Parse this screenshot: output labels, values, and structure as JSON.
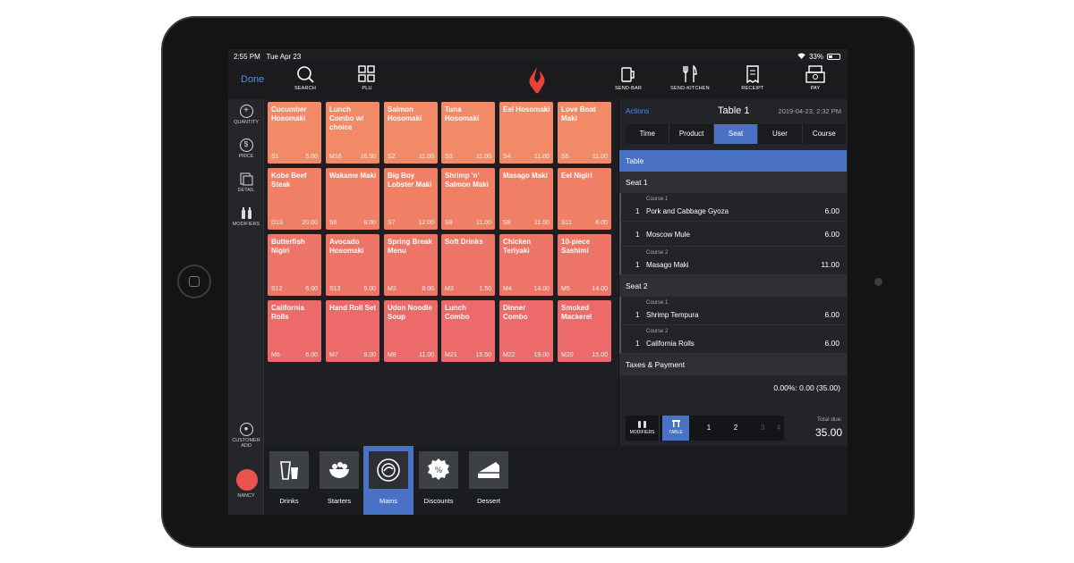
{
  "status": {
    "time": "2:55 PM",
    "date": "Tue Apr 23",
    "battery": "33%"
  },
  "toolbar": {
    "done_label": "Done",
    "search_label": "SEARCH",
    "plu_label": "PLU",
    "send_bar_label": "SEND-BAR",
    "send_kitchen_label": "SEND-KITCHEN",
    "receipt_label": "RECEIPT",
    "pay_label": "PAY"
  },
  "sidebar": {
    "quantity_label": "QUANTITY",
    "price_label": "PRICE",
    "detail_label": "DETAIL",
    "modifiers_label": "MODIFIERS",
    "customer_label": "CUSTOMER",
    "add_label": "ADD",
    "user_label": "NANCY"
  },
  "colors": {
    "accent": "#4a72c4",
    "link": "#4f8dfc",
    "tile_light": "#f08c6a",
    "tile_dark": "#ec6a6a"
  },
  "products": [
    [
      {
        "name": "Cucumber Hosomaki",
        "code": "S1",
        "price": "5.00"
      },
      {
        "name": "Lunch Combo w/ choice",
        "code": "M16",
        "price": "16.50"
      },
      {
        "name": "Salmon Hosomaki",
        "code": "S2",
        "price": "11.00"
      },
      {
        "name": "Tuna Hosomaki",
        "code": "S3",
        "price": "11.00"
      },
      {
        "name": "Eel Hosomaki",
        "code": "S4",
        "price": "11.00"
      },
      {
        "name": "Love Boat Maki",
        "code": "S5",
        "price": "11.00"
      }
    ],
    [
      {
        "name": "Kobe Beef Steak",
        "code": "D13",
        "price": "20.00"
      },
      {
        "name": "Wakame Maki",
        "code": "S6",
        "price": "8.00"
      },
      {
        "name": "Big Boy Lobster Maki",
        "code": "S7",
        "price": "12.00"
      },
      {
        "name": "Shrimp 'n' Salmon Maki",
        "code": "S8",
        "price": "11.00"
      },
      {
        "name": "Masago Maki",
        "code": "S9",
        "price": "11.00"
      },
      {
        "name": "Eel Nigiri",
        "code": "S11",
        "price": "6.00"
      }
    ],
    [
      {
        "name": "Butterfish Nigiri",
        "code": "S12",
        "price": "6.00"
      },
      {
        "name": "Avocado Hosomaki",
        "code": "S13",
        "price": "5.00"
      },
      {
        "name": "Spring Break Menu",
        "code": "M2",
        "price": "8.00"
      },
      {
        "name": "Soft Drinks",
        "code": "M3",
        "price": "1.50"
      },
      {
        "name": "Chicken Teriyaki",
        "code": "M4",
        "price": "14.00"
      },
      {
        "name": "10-piece Sashimi",
        "code": "M5",
        "price": "14.00"
      }
    ],
    [
      {
        "name": "California Rolls",
        "code": "M6",
        "price": "6.00"
      },
      {
        "name": "Hand Roll Set",
        "code": "M7",
        "price": "9.00"
      },
      {
        "name": "Udon Noodle Soup",
        "code": "M8",
        "price": "11.00"
      },
      {
        "name": "Lunch Combo",
        "code": "M21",
        "price": "15.50"
      },
      {
        "name": "Dinner Combo",
        "code": "M22",
        "price": "19.00"
      },
      {
        "name": "Smoked Mackerel",
        "code": "M20",
        "price": "15.00"
      }
    ]
  ],
  "order": {
    "actions_label": "Actions",
    "title": "Table 1",
    "datetime": "2019-04-23, 2:32 PM",
    "tabs": [
      "Time",
      "Product",
      "Seat",
      "User",
      "Course"
    ],
    "active_tab": "Seat",
    "table_section": "Table",
    "seat1_label": "Seat 1",
    "seat2_label": "Seat 2",
    "items": [
      {
        "course": "Course 1",
        "qty": "1",
        "name": "Pork and Cabbage Gyoza",
        "amount": "6.00"
      },
      {
        "course": "",
        "qty": "1",
        "name": "Moscow Mule",
        "amount": "6.00"
      },
      {
        "course": "Course 2",
        "qty": "1",
        "name": "Masago Maki",
        "amount": "11.00"
      },
      {
        "course": "Course 1",
        "qty": "1",
        "name": "Shrimp Tempura",
        "amount": "6.00"
      },
      {
        "course": "Course 2",
        "qty": "1",
        "name": "California Rolls",
        "amount": "6.00"
      }
    ],
    "taxes_label": "Taxes & Payment",
    "tax_line": "0.00%: 0.00 (35.00)",
    "modifiers_label": "MODIFIERS",
    "table_label": "TABLE",
    "seat_numbers": [
      "1",
      "2",
      "3",
      "4"
    ],
    "total_label": "Total due:",
    "total_value": "35.00"
  },
  "categories": [
    {
      "label": "Drinks",
      "icon": "drinks-icon"
    },
    {
      "label": "Starters",
      "icon": "starters-icon"
    },
    {
      "label": "Mains",
      "icon": "mains-icon",
      "active": true
    },
    {
      "label": "Discounts",
      "icon": "discounts-icon"
    },
    {
      "label": "Dessert",
      "icon": "dessert-icon"
    }
  ]
}
